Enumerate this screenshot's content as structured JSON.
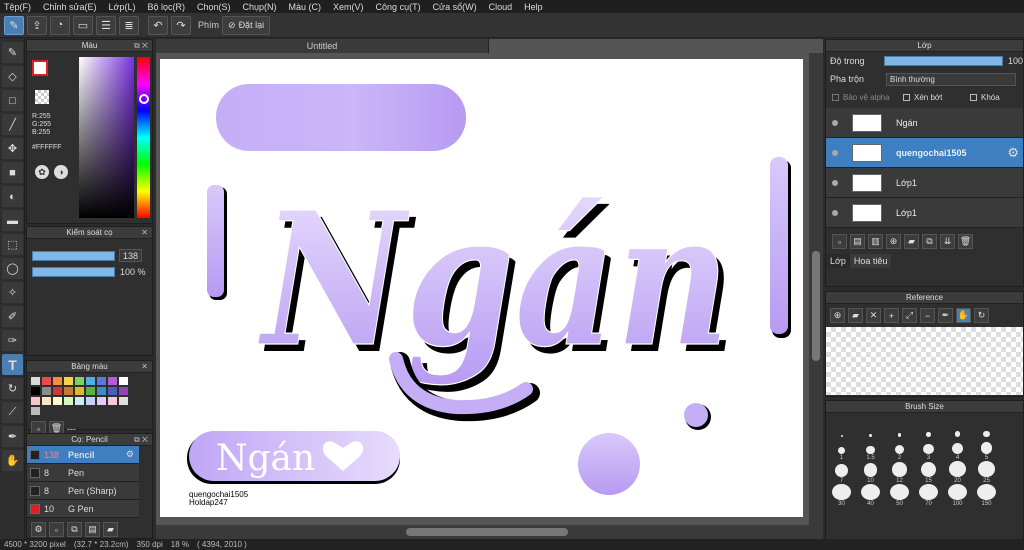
{
  "menu": [
    "Tệp(F)",
    "Chỉnh sửa(E)",
    "Lớp(L)",
    "Bộ lọc(R)",
    "Chọn(S)",
    "Chụp(N)",
    "Màu (C)",
    "Xem(V)",
    "Công cụ(T)",
    "Cửa sổ(W)",
    "Cloud",
    "Help"
  ],
  "toolbar": {
    "phim_label": "Phím",
    "reset_label": "Đặt lại"
  },
  "color_panel": {
    "title": "Màu",
    "r": "R:255",
    "g": "G:255",
    "b": "B:255",
    "hex": "#FFFFFF"
  },
  "brush_control": {
    "title": "Kiểm soát cọ",
    "size": "138",
    "opacity": "100 %"
  },
  "palette": {
    "title": "Bảng màu",
    "extra": "---",
    "colors": [
      "#d9d9d9",
      "#e84b4b",
      "#f0903c",
      "#f3d54a",
      "#7fd15f",
      "#4fb0e0",
      "#5b7ad8",
      "#b05bd8",
      "#ffffff",
      "#000000",
      "#8c8c8c",
      "#c23a3a",
      "#c87830",
      "#d9bb30",
      "#5cb040",
      "#3b8ec0",
      "#4a5fb8",
      "#8e45b8",
      "#f7c8c8",
      "#fde6c8",
      "#fffac8",
      "#d8f5c8",
      "#c8ecfa",
      "#c8d0f5",
      "#e8c8f5",
      "#f5c8e0",
      "#e0e0e0",
      "#bbbbbb"
    ]
  },
  "brush_list": {
    "title": "Cọ: Pencil",
    "items": [
      {
        "size": "138",
        "name": "Pencil",
        "color": "#222222",
        "selected": true
      },
      {
        "size": "8",
        "name": "Pen",
        "color": "#222222",
        "selected": false
      },
      {
        "size": "8",
        "name": "Pen (Sharp)",
        "color": "#222222",
        "selected": false
      },
      {
        "size": "10",
        "name": "G Pen",
        "color": "#e02020",
        "selected": false
      }
    ]
  },
  "canvas": {
    "tab": "Untitled",
    "big_word": "Ngán",
    "small_word": "Ngán",
    "watermark_1": "quengochai1505",
    "watermark_2": "Holdap247"
  },
  "layers": {
    "title": "Lớp",
    "opacity_label": "Độ trong",
    "opacity_value": "100",
    "blend_label": "Pha trộn",
    "blend_value": "Bình thường",
    "protect_alpha": "Bảo vệ alpha",
    "clipping": "Xén bớt",
    "lock": "Khóa",
    "items": [
      {
        "name": "Ngán",
        "selected": false
      },
      {
        "name": "quengochai1505",
        "selected": true
      },
      {
        "name": "Lớp1",
        "selected": false
      },
      {
        "name": "Lớp1",
        "selected": false
      }
    ],
    "tabs": [
      "Lớp",
      "Hoa tiêu"
    ]
  },
  "reference": {
    "title": "Reference"
  },
  "brush_size": {
    "title": "Brush Size",
    "sizes": [
      "",
      "",
      "",
      "",
      "",
      "",
      "1",
      "1.5",
      "2",
      "3",
      "4",
      "5",
      "7",
      "10",
      "12",
      "15",
      "20",
      "25",
      "30",
      "40",
      "50",
      "70",
      "100",
      "150"
    ]
  },
  "status": {
    "dimensions": "4500 * 3200 pixel",
    "physical": "(32.7 * 23.2cm)",
    "dpi": "350 dpi",
    "zoom": "18 %",
    "coords": "( 4394, 2010 )"
  },
  "accent": "#4a7fb5",
  "lettering_color": "#c6aef7"
}
